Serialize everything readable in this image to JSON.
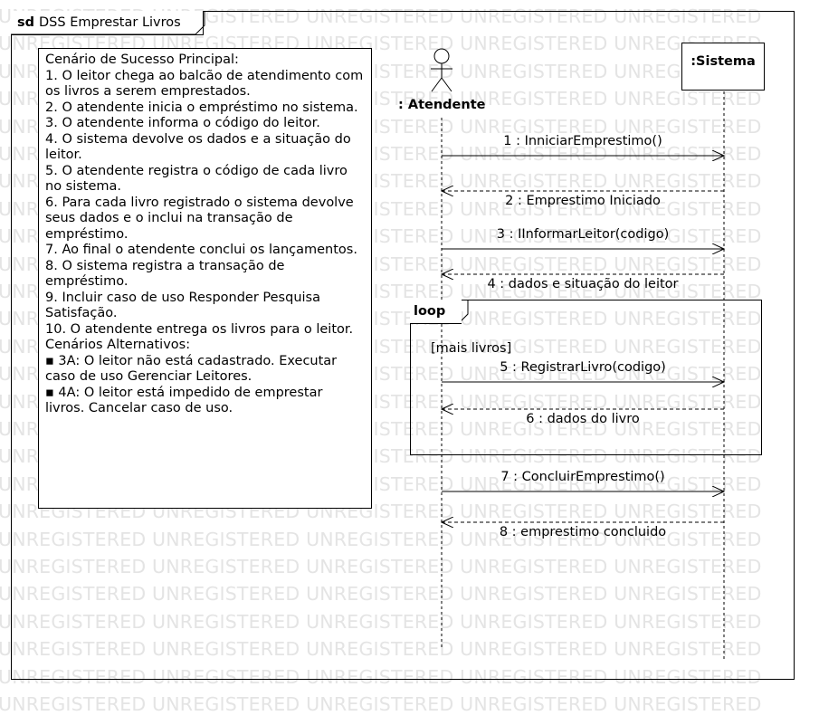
{
  "watermark_text": "UNREGISTERED UNREGISTERED UNREGISTERED UNREGISTERED UNREGISTERED",
  "frame": {
    "keyword": "sd",
    "name": "DSS Emprestar Livros"
  },
  "note": {
    "lines": [
      "Cenário de Sucesso Principal:",
      "1. O leitor chega ao balcão de atendimento com os livros a serem emprestados.",
      "2. O atendente inicia o empréstimo no sistema.",
      "3. O atendente informa o código do leitor.",
      "4. O sistema devolve os dados e a situação do leitor.",
      "5. O atendente registra o código de cada livro no sistema.",
      "6. Para cada livro registrado o sistema devolve seus dados e o inclui na transação de empréstimo.",
      "7. Ao final o atendente conclui os lançamentos.",
      "8. O sistema registra a transação de empréstimo.",
      "9. Incluir caso de uso Responder Pesquisa Satisfação.",
      "10. O atendente entrega os livros para o leitor.",
      "Cenários Alternativos:",
      "▪ 3A: O leitor não está cadastrado. Executar caso de uso Gerenciar Leitores.",
      "▪ 4A: O leitor está impedido de emprestar livros. Cancelar caso de uso."
    ]
  },
  "lifelines": {
    "actor": ": Atendente",
    "system": ":Sistema"
  },
  "loop": {
    "label": "loop",
    "guard": "[mais livros]"
  },
  "messages": [
    {
      "label": "1 : InniciarEmprestimo()",
      "kind": "call"
    },
    {
      "label": "2 : Emprestimo Iniciado",
      "kind": "return"
    },
    {
      "label": "3 : IInformarLeitor(codigo)",
      "kind": "call"
    },
    {
      "label": "4 : dados e situação do leitor",
      "kind": "return"
    },
    {
      "label": "5 : RegistrarLivro(codigo)",
      "kind": "call"
    },
    {
      "label": "6 : dados do livro",
      "kind": "return"
    },
    {
      "label": "7 : ConcluirEmprestimo()",
      "kind": "call"
    },
    {
      "label": "8 : emprestimo concluido",
      "kind": "return"
    }
  ]
}
